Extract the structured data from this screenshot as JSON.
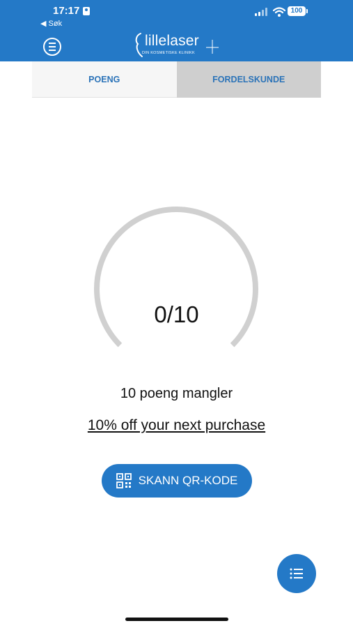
{
  "status_bar": {
    "time": "17:17",
    "back_label": "◀ Søk",
    "battery": "100"
  },
  "header": {
    "menu_icon": "menu-icon",
    "logo_text": "lillelaser",
    "logo_subtitle": "DIN KOSMETISKE KLINIKK"
  },
  "tabs": [
    {
      "label": "POENG",
      "active": true
    },
    {
      "label": "FORDELSKUNDE",
      "active": false
    }
  ],
  "points": {
    "current": 0,
    "total": 10,
    "display": "0/10"
  },
  "missing_text": "10 poeng mangler",
  "reward_link": "10% off your next purchase",
  "scan_button": {
    "label": "SKANN QR-KODE",
    "icon": "qr-code-icon"
  },
  "fab": {
    "icon": "list-icon"
  },
  "colors": {
    "primary": "#2479c7",
    "gauge_track": "#d0d0d0",
    "tab_inactive": "#cfcfcf",
    "tab_active": "#f6f6f6"
  }
}
